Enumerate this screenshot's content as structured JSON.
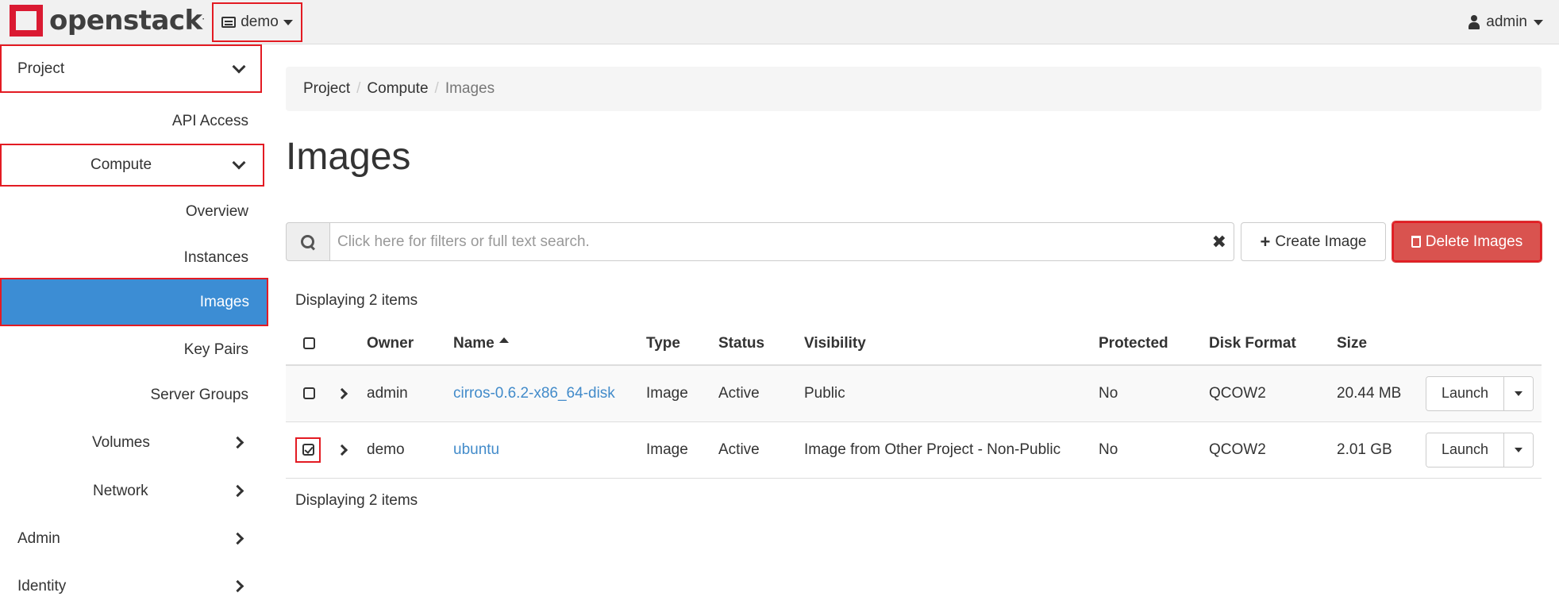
{
  "brand": {
    "name": "openstack",
    "mark": "."
  },
  "header": {
    "project": "demo",
    "user": "admin"
  },
  "sidebar": {
    "project": "Project",
    "api_access": "API Access",
    "compute": "Compute",
    "overview": "Overview",
    "instances": "Instances",
    "images": "Images",
    "key_pairs": "Key Pairs",
    "server_groups": "Server Groups",
    "volumes": "Volumes",
    "network": "Network",
    "admin": "Admin",
    "identity": "Identity"
  },
  "breadcrumb": [
    "Project",
    "Compute",
    "Images"
  ],
  "page_title": "Images",
  "search": {
    "placeholder": "Click here for filters or full text search.",
    "value": ""
  },
  "actions": {
    "create": "Create Image",
    "delete": "Delete Images"
  },
  "count_text": "Displaying 2 items",
  "table": {
    "columns": {
      "owner": "Owner",
      "name": "Name",
      "type": "Type",
      "status": "Status",
      "visibility": "Visibility",
      "protected": "Protected",
      "disk_format": "Disk Format",
      "size": "Size"
    },
    "rows": [
      {
        "owner": "admin",
        "name": "cirros-0.6.2-x86_64-disk",
        "type": "Image",
        "status": "Active",
        "visibility": "Public",
        "protected": "No",
        "disk_format": "QCOW2",
        "size": "20.44 MB",
        "action": "Launch",
        "checked": false
      },
      {
        "owner": "demo",
        "name": "ubuntu",
        "type": "Image",
        "status": "Active",
        "visibility": "Image from Other Project - Non-Public",
        "protected": "No",
        "disk_format": "QCOW2",
        "size": "2.01 GB",
        "action": "Launch",
        "checked": true
      }
    ]
  },
  "colors": {
    "accent": "#3c8dd4",
    "danger": "#d9534f",
    "brand": "#da1a32",
    "link": "#428bca",
    "highlight": "#e31b23"
  }
}
